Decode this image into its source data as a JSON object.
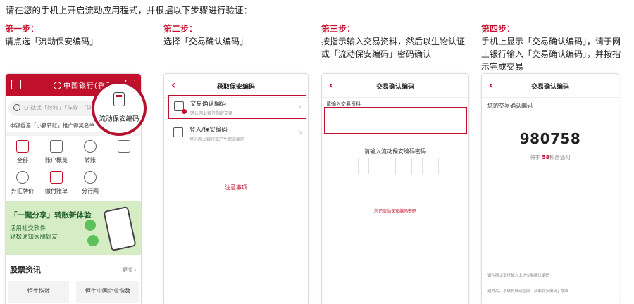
{
  "intro": "请在您的手机上开启流动应用程式，并根据以下步骤进行验证：",
  "steps": [
    {
      "title": "第一步：",
      "desc": [
        "请点选「流动保安编码」"
      ]
    },
    {
      "title": "第二步：",
      "desc": [
        "选择「交易确认编码」"
      ]
    },
    {
      "title": "第三步：",
      "desc": [
        "按指示输入交易资料，然后以生物认证",
        "或「流动保安编码」密码确认"
      ]
    },
    {
      "title": "第四步：",
      "desc": [
        "手机上显示「交易确认编码」，请于网",
        "上银行输入「交易确认编码」，并按指",
        "示完成交易"
      ]
    }
  ],
  "phone1": {
    "logo": "中国银行(香港)",
    "search_placeholder": "Q 试试「转账」「存款」「外汇",
    "promo": "中银香港「小额转账」推广得奖名单",
    "icons": [
      {
        "label": "全部",
        "icon": "grid-icon"
      },
      {
        "label": "账户概览",
        "icon": "account-icon"
      },
      {
        "label": "转账",
        "icon": "transfer-icon"
      },
      {
        "label": "",
        "icon": "chart-icon"
      },
      {
        "label": "外汇牌价",
        "icon": "fx-icon"
      },
      {
        "label": "缴付账单",
        "icon": "bill-icon"
      },
      {
        "label": "分行网",
        "icon": "branch-icon"
      }
    ],
    "highlight_label": "流动保安编码",
    "banner_title": "「一键分享」转账新体验",
    "banner_sub": [
      "活用社交软件",
      "轻松通知家朋好友"
    ],
    "stock_title": "股票资讯",
    "stock_more": "更多 ›",
    "stock_cards": [
      "恒生指数",
      "恒生中国企业指数"
    ]
  },
  "phone2": {
    "title": "获取保安编码",
    "options": [
      {
        "title": "交易确认编码",
        "sub": "确认网上银行指定交易"
      },
      {
        "title": "登入/保安编码",
        "sub": "登入网上银行或产生保安编码"
      }
    ],
    "notice": "注意事项"
  },
  "phone3": {
    "title": "交易确认编码",
    "input_label": "请输入交易资料",
    "code_label": "请输入流动保安编码密码",
    "forgot": "忘记流动保安编码密码"
  },
  "phone4": {
    "title": "交易确认编码",
    "label": "您的交易确认编码",
    "code": "980758",
    "timer_prefix": "将于",
    "timer_seconds": "58",
    "timer_suffix": "秒后逾时",
    "notes": [
      "请在网上银行输入上述交易确认编码",
      "逾时后，系统将自动返回「获取保安编码」版面"
    ]
  }
}
